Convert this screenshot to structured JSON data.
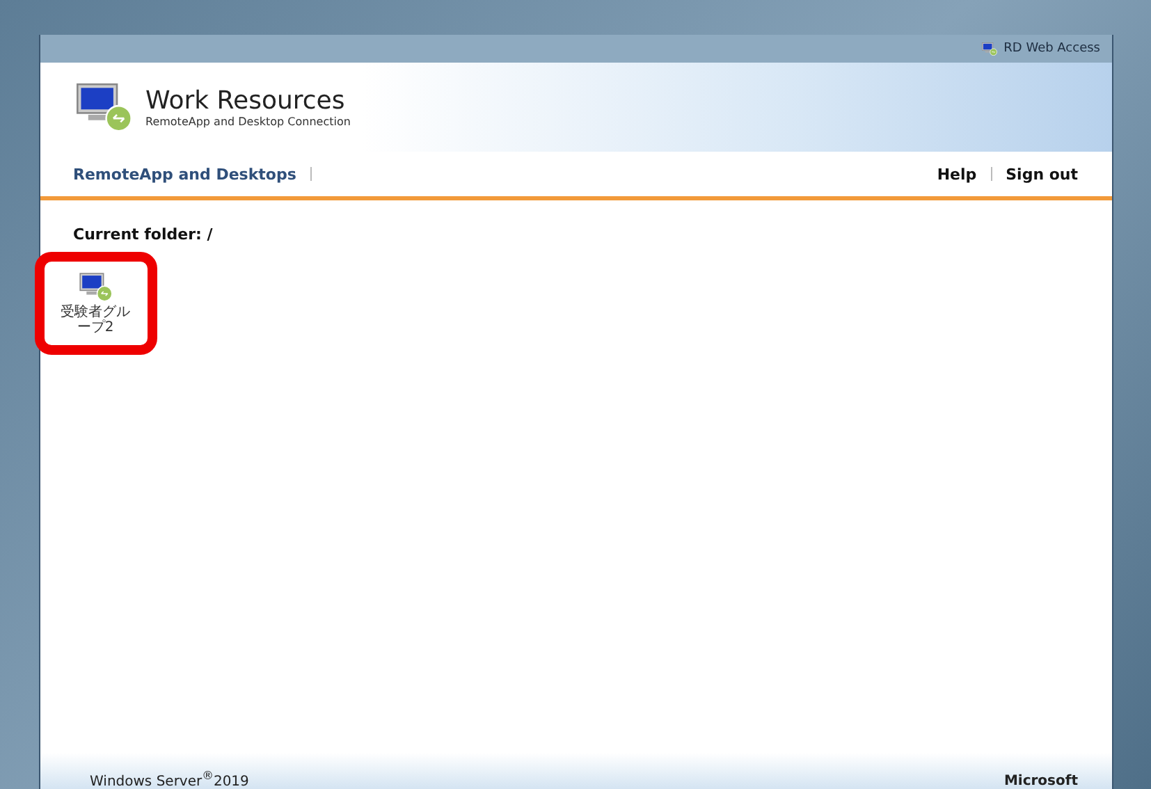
{
  "top_bar": {
    "title": "RD Web Access"
  },
  "header": {
    "title": "Work Resources",
    "subtitle": "RemoteApp and Desktop Connection"
  },
  "nav": {
    "left": [
      {
        "label": "RemoteApp and Desktops",
        "selected": true
      }
    ],
    "right": [
      {
        "label": "Help"
      },
      {
        "label": "Sign out"
      }
    ]
  },
  "folder": {
    "label": "Current folder: /"
  },
  "resources": [
    {
      "label": "受験者グループ2",
      "highlighted": true
    }
  ],
  "footer": {
    "left": "Windows Server$^{®}$2019",
    "right": "Microsoft"
  }
}
